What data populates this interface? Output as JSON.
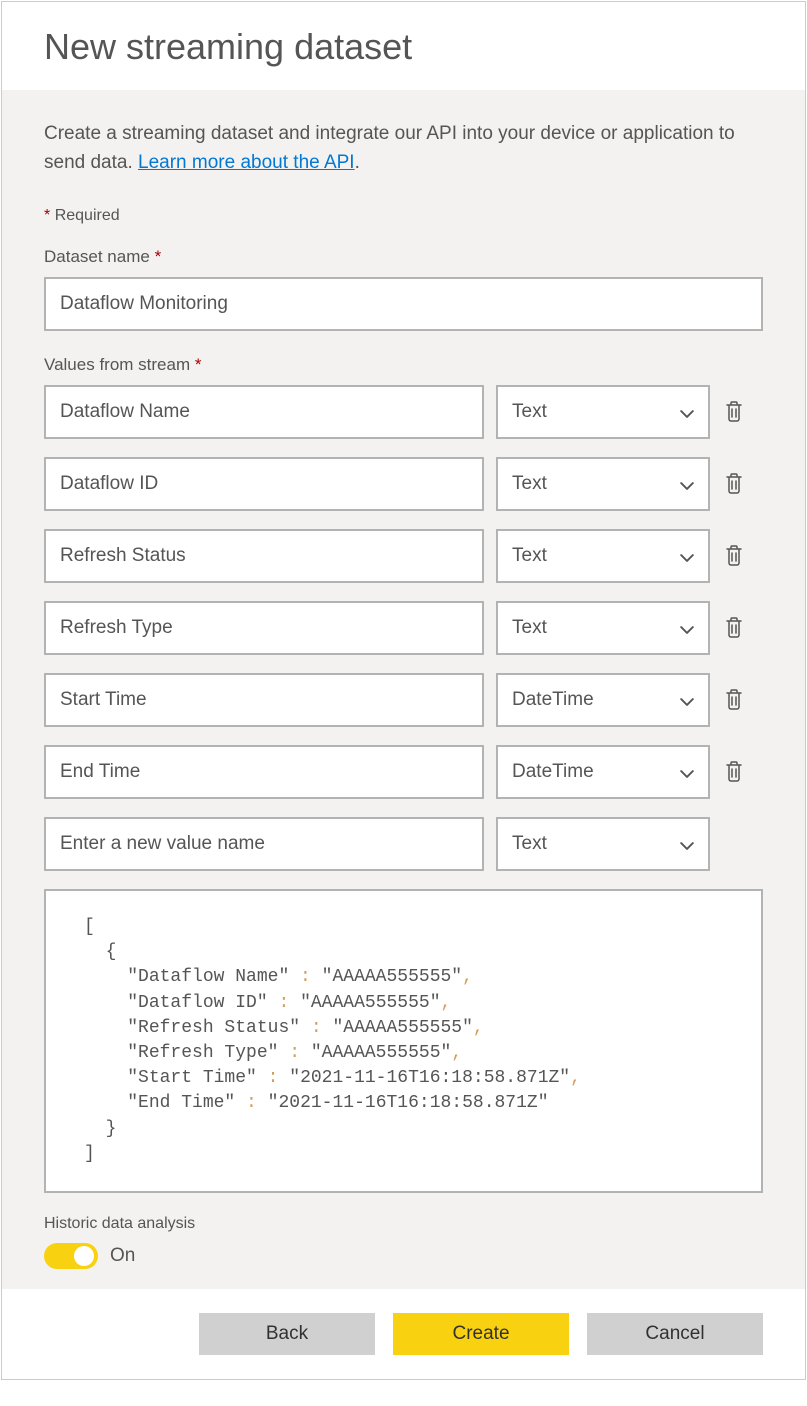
{
  "header": {
    "title": "New streaming dataset"
  },
  "description": {
    "text_before": "Create a streaming dataset and integrate our API into your device or application to send data. ",
    "link_text": "Learn more about the API",
    "text_after": "."
  },
  "required_note": "Required",
  "dataset_name": {
    "label": "Dataset name",
    "value": "Dataflow Monitoring"
  },
  "values_from_stream": {
    "label": "Values from stream",
    "rows": [
      {
        "name": "Dataflow Name",
        "type": "Text"
      },
      {
        "name": "Dataflow ID",
        "type": "Text"
      },
      {
        "name": "Refresh Status",
        "type": "Text"
      },
      {
        "name": "Refresh Type",
        "type": "Text"
      },
      {
        "name": "Start Time",
        "type": "DateTime"
      },
      {
        "name": "End Time",
        "type": "DateTime"
      }
    ],
    "new_row": {
      "placeholder": "Enter a new value name",
      "type": "Text"
    }
  },
  "json_preview": {
    "lines": [
      {
        "indent": 0,
        "raw": "["
      },
      {
        "indent": 1,
        "raw": "{"
      },
      {
        "indent": 2,
        "key": "Dataflow Name",
        "value": "AAAAA555555",
        "comma": true
      },
      {
        "indent": 2,
        "key": "Dataflow ID",
        "value": "AAAAA555555",
        "comma": true
      },
      {
        "indent": 2,
        "key": "Refresh Status",
        "value": "AAAAA555555",
        "comma": true
      },
      {
        "indent": 2,
        "key": "Refresh Type",
        "value": "AAAAA555555",
        "comma": true
      },
      {
        "indent": 2,
        "key": "Start Time",
        "value": "2021-11-16T16:18:58.871Z",
        "comma": true
      },
      {
        "indent": 2,
        "key": "End Time",
        "value": "2021-11-16T16:18:58.871Z",
        "comma": false
      },
      {
        "indent": 1,
        "raw": "}"
      },
      {
        "indent": 0,
        "raw": "]"
      }
    ]
  },
  "historic": {
    "label": "Historic data analysis",
    "state": "On"
  },
  "footer": {
    "back": "Back",
    "create": "Create",
    "cancel": "Cancel"
  }
}
